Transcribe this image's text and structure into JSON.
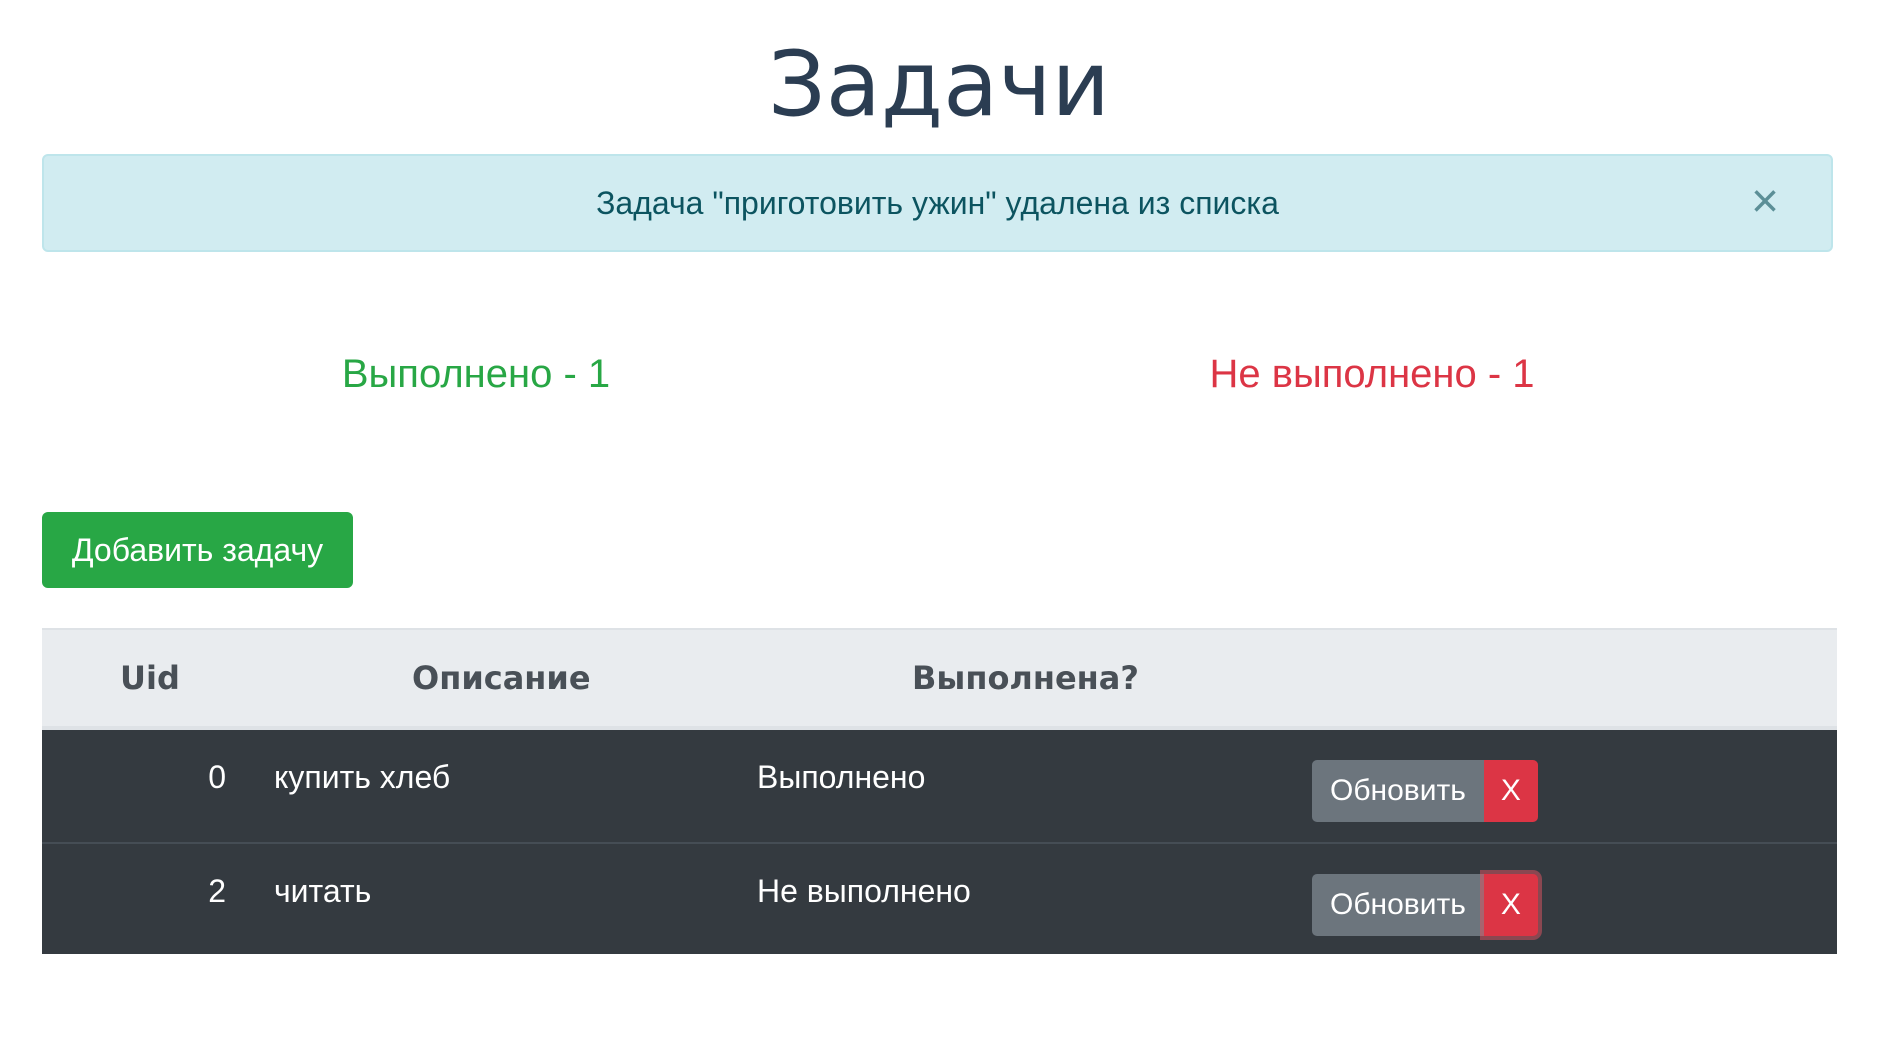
{
  "page": {
    "title": "Задачи"
  },
  "alert": {
    "message": "Задача \"приготовить ужин\" удалена из списка",
    "close_icon": "close-icon",
    "close_glyph": "×"
  },
  "stats": {
    "done_label": "Выполнено - 1",
    "not_done_label": "Не выполнено - 1"
  },
  "toolbar": {
    "add_label": "Добавить задачу"
  },
  "table": {
    "headers": {
      "uid": "Uid",
      "description": "Описание",
      "done": "Выполнена?"
    },
    "rows": [
      {
        "uid": "0",
        "description": "купить хлеб",
        "status": "Выполнено",
        "update_label": "Обновить",
        "delete_label": "X"
      },
      {
        "uid": "2",
        "description": "читать",
        "status": "Не выполнено",
        "update_label": "Обновить",
        "delete_label": "X"
      }
    ]
  },
  "colors": {
    "success": "#28a745",
    "danger": "#dc3545",
    "secondary": "#6c757d",
    "dark": "#343a40",
    "info_bg": "#d1ecf1",
    "title": "#2b3d52"
  }
}
